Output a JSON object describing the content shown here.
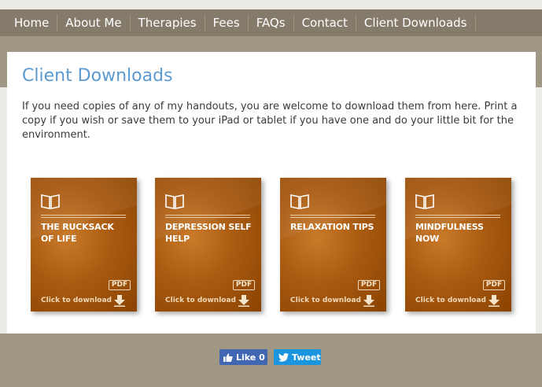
{
  "nav": {
    "items": [
      {
        "label": "Home"
      },
      {
        "label": "About Me"
      },
      {
        "label": "Therapies"
      },
      {
        "label": "Fees"
      },
      {
        "label": "FAQs"
      },
      {
        "label": "Contact"
      },
      {
        "label": "Client Downloads"
      }
    ]
  },
  "page": {
    "title": "Client Downloads",
    "intro": "If you need copies of any of my handouts, you are welcome to download them from here. Print a copy if you wish or save them to your iPad or tablet if you have one and do your little bit for the environment."
  },
  "downloads": [
    {
      "title": "THE RUCKSACK OF LIFE",
      "badge": "PDF",
      "action": "Click to download",
      "icon": "book-icon"
    },
    {
      "title": "DEPRESSION SELF HELP",
      "badge": "PDF",
      "action": "Click to download",
      "icon": "book-icon"
    },
    {
      "title": "RELAXATION TIPS",
      "badge": "PDF",
      "action": "Click to download",
      "icon": "book-icon"
    },
    {
      "title": "MINDFULNESS NOW",
      "badge": "PDF",
      "action": "Click to download",
      "icon": "book-icon"
    }
  ],
  "social": {
    "like_label": "Like 0",
    "tweet_label": "Tweet"
  },
  "colors": {
    "nav_bg": "#857b6b",
    "band_bg": "#a09884",
    "title": "#5c9ad0",
    "card_orange": "#a95a10",
    "facebook": "#4267b2",
    "twitter": "#1b95e0"
  }
}
